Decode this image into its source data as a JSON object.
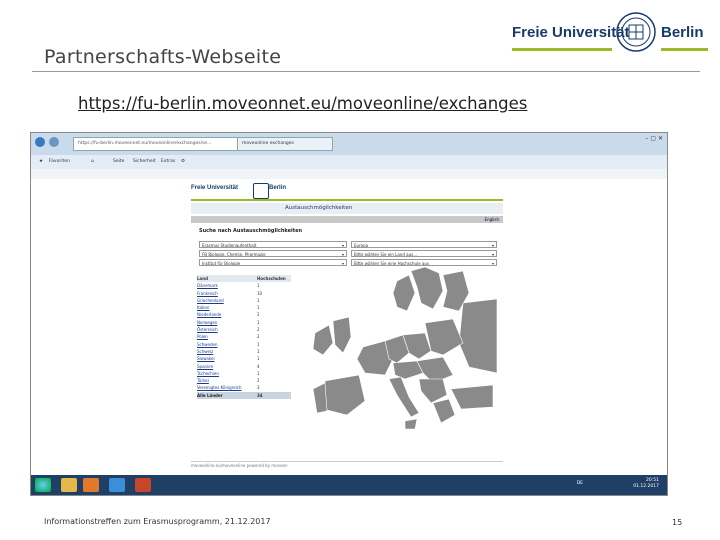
{
  "slide": {
    "title": "Partnerschafts-Webseite",
    "url": "https://fu-berlin.moveonnet.eu/moveonline/exchanges",
    "footer_text": "Informationstreffen zum Erasmusprogramm, 21.12.2017",
    "page_number": "15"
  },
  "logo": {
    "left_text": "Freie Universität",
    "right_text": "Berlin",
    "accent_color": "#9bbb26",
    "brand_color": "#1a3a6c"
  },
  "browser": {
    "address": "https://fu-berlin.moveonnet.eu/moveonline/exchanges/se...",
    "tab_label": "moveonline exchanges",
    "favorites_label": "Favoriten",
    "command_items": [
      "Seite",
      "Sicherheit",
      "Extras"
    ],
    "window_controls": "– ▢ ✕",
    "icons": [
      "back-icon",
      "forward-icon",
      "home-icon",
      "star-icon",
      "gear-icon"
    ]
  },
  "webpage": {
    "logo_left": "Freie Universität",
    "logo_right": "Berlin",
    "header_title": "Austauschmöglichkeiten",
    "language": "English",
    "search_heading": "Suche nach Austauschmöglichkeiten",
    "filters": [
      {
        "value": "Erasmus Studienaufenthalt"
      },
      {
        "value": "Europa"
      },
      {
        "value": "FB Biologie, Chemie, Pharmazie"
      },
      {
        "value": "Bitte wählen Sie ein Land aus..."
      },
      {
        "value": "Institut für Biologie"
      },
      {
        "value": "Bitte wählen Sie eine Hochschule aus"
      }
    ],
    "table_headers": [
      "Land",
      "Hochschulen"
    ],
    "countries": [
      {
        "name": "Dänemark",
        "count": "1"
      },
      {
        "name": "Frankreich",
        "count": "10"
      },
      {
        "name": "Griechenland",
        "count": "1"
      },
      {
        "name": "Italien",
        "count": "1"
      },
      {
        "name": "Niederlande",
        "count": "2"
      },
      {
        "name": "Norwegen",
        "count": "1"
      },
      {
        "name": "Österreich",
        "count": "2"
      },
      {
        "name": "Polen",
        "count": "2"
      },
      {
        "name": "Schweden",
        "count": "1"
      },
      {
        "name": "Schweiz",
        "count": "1"
      },
      {
        "name": "Slowakei",
        "count": "1"
      },
      {
        "name": "Spanien",
        "count": "4"
      },
      {
        "name": "Tschechien",
        "count": "1"
      },
      {
        "name": "Türkei",
        "count": "2"
      },
      {
        "name": "Vereinigtes Königreich",
        "count": "3"
      }
    ],
    "total_label": "Alle Länder",
    "total_count": "34",
    "footer": "moveonline.eu/moveonline powered by moveon"
  },
  "taskbar": {
    "language": "DE",
    "time": "20:51",
    "date": "01.12.2017",
    "apps": [
      "windows-start-icon",
      "explorer-icon",
      "media-player-icon",
      "internet-explorer-icon",
      "powerpoint-icon"
    ]
  }
}
